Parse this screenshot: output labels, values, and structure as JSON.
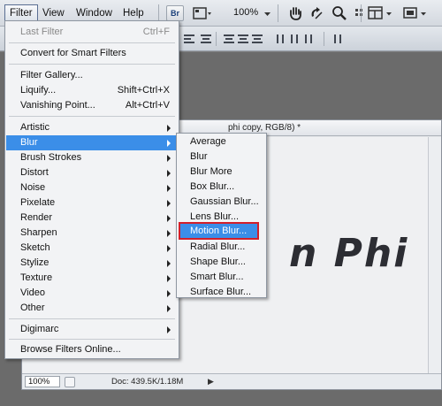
{
  "menubar": {
    "items": [
      "Filter",
      "View",
      "Window",
      "Help"
    ],
    "br_label": "Br",
    "zoom": "100%"
  },
  "document": {
    "title": "phi copy, RGB/8) *",
    "canvas_text": "n Phi",
    "zoom_field": "100%",
    "doc_info": "Doc: 439.5K/1.18M"
  },
  "filter_menu": {
    "last_filter": {
      "label": "Last Filter",
      "shortcut": "Ctrl+F"
    },
    "convert": "Convert for Smart Filters",
    "gallery": "Filter Gallery...",
    "liquify": {
      "label": "Liquify...",
      "shortcut": "Shift+Ctrl+X"
    },
    "vanishing": {
      "label": "Vanishing Point...",
      "shortcut": "Alt+Ctrl+V"
    },
    "groups": [
      "Artistic",
      "Blur",
      "Brush Strokes",
      "Distort",
      "Noise",
      "Pixelate",
      "Render",
      "Sharpen",
      "Sketch",
      "Stylize",
      "Texture",
      "Video",
      "Other"
    ],
    "digimarc": "Digimarc",
    "browse": "Browse Filters Online..."
  },
  "blur_submenu": {
    "items": [
      "Average",
      "Blur",
      "Blur More",
      "Box Blur...",
      "Gaussian Blur...",
      "Lens Blur...",
      "Motion Blur...",
      "Radial Blur...",
      "Shape Blur...",
      "Smart Blur...",
      "Surface Blur..."
    ],
    "highlighted": "Motion Blur..."
  },
  "colors": {
    "highlight": "#3b8ee8",
    "selection_outline": "#d21f2a"
  }
}
